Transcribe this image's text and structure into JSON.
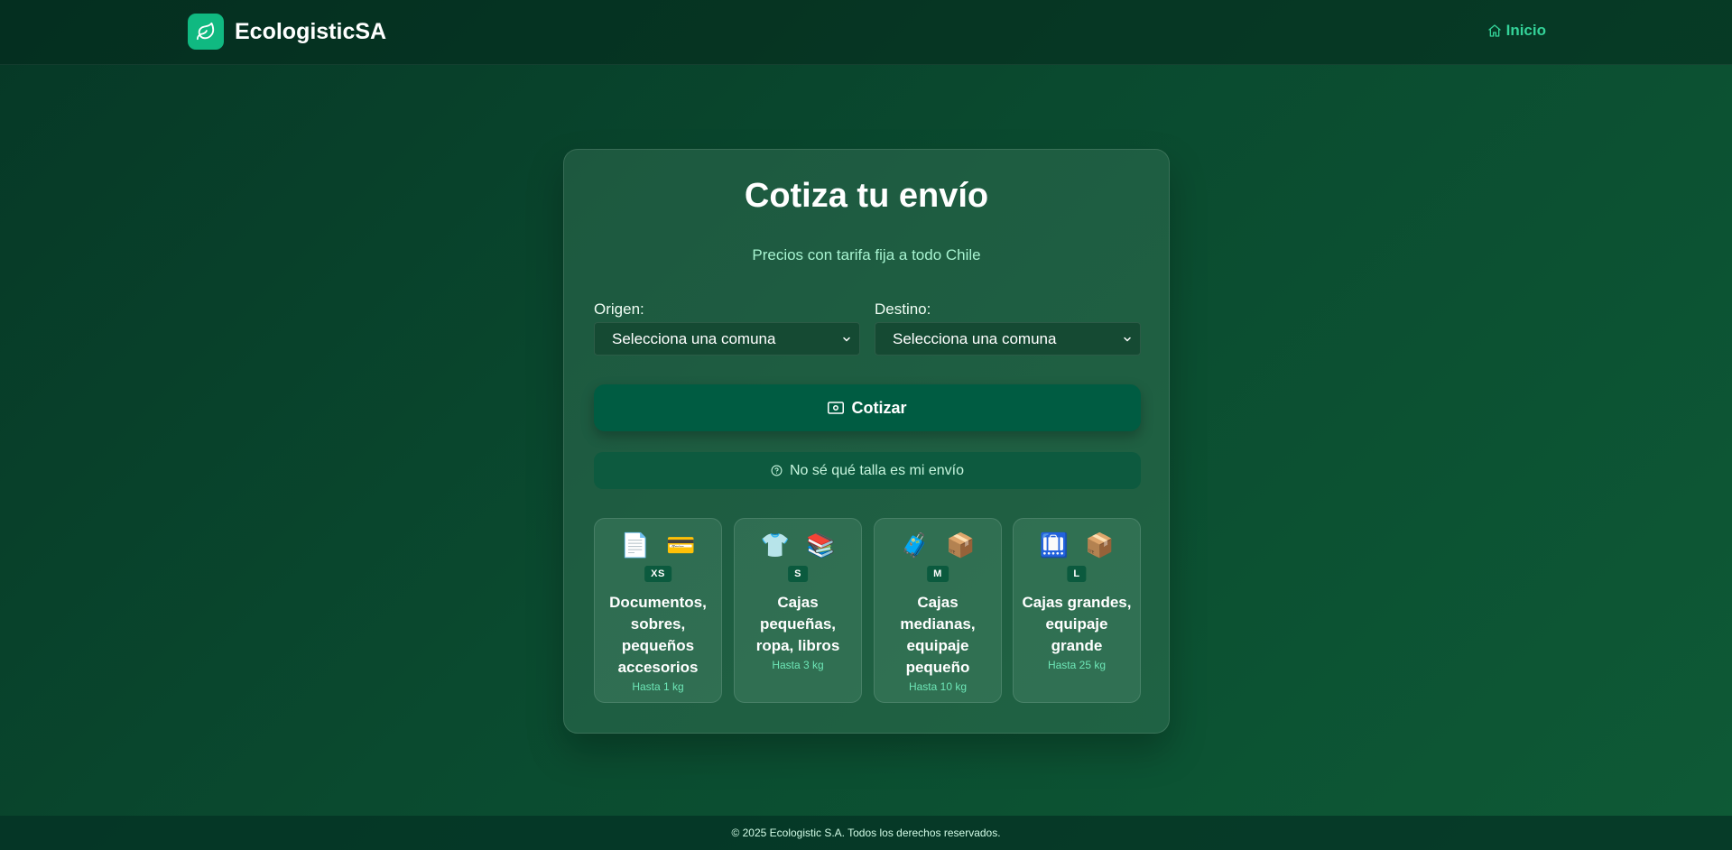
{
  "header": {
    "brand_name": "EcologisticSA",
    "nav_home": "Inicio"
  },
  "quote": {
    "title": "Cotiza tu envío",
    "subtitle": "Precios con tarifa fija a todo Chile",
    "origin_label": "Origen:",
    "origin_value": "Selecciona una comuna",
    "destination_label": "Destino:",
    "destination_value": "Selecciona una comuna",
    "submit_label": "Cotizar",
    "help_label": "No sé qué talla es mi envío"
  },
  "sizes": [
    {
      "code": "XS",
      "icons": [
        "📄",
        "💳"
      ],
      "icon_names": [
        "document-icon",
        "credit-card-icon"
      ],
      "description": "Documentos, sobres, pequeños accesorios",
      "weight": "Hasta 1 kg"
    },
    {
      "code": "S",
      "icons": [
        "👕",
        "📚"
      ],
      "icon_names": [
        "tshirt-icon",
        "books-icon"
      ],
      "description": "Cajas pequeñas, ropa, libros",
      "weight": "Hasta 3 kg"
    },
    {
      "code": "M",
      "icons": [
        "🧳",
        "📦"
      ],
      "icon_names": [
        "suitcase-icon",
        "package-icon"
      ],
      "description": "Cajas medianas, equipaje pequeño",
      "weight": "Hasta 10 kg"
    },
    {
      "code": "L",
      "icons": [
        "🛄",
        "📦"
      ],
      "icon_names": [
        "luggage-icon",
        "package-icon"
      ],
      "description": "Cajas grandes, equipaje grande",
      "weight": "Hasta 25 kg"
    }
  ],
  "footer": {
    "copyright": "© 2025 Ecologistic S.A. Todos los derechos reservados."
  },
  "colors": {
    "accent": "#10b981",
    "accent_text": "#34d399",
    "primary_button": "#005c42"
  }
}
